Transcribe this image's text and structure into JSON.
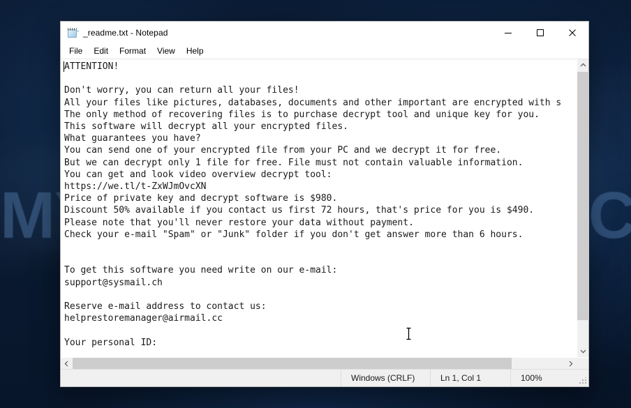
{
  "desktop": {
    "watermark_text": "MYANTISPYWARE.COM",
    "background_color": "#0a1b33",
    "watermark_color": "#78aae6"
  },
  "window": {
    "title": "_readme.txt - Notepad",
    "icon": "notepad-icon",
    "controls": {
      "minimize": "Minimize",
      "maximize": "Maximize",
      "close": "Close"
    }
  },
  "menubar": {
    "items": [
      {
        "label": "File"
      },
      {
        "label": "Edit"
      },
      {
        "label": "Format"
      },
      {
        "label": "View"
      },
      {
        "label": "Help"
      }
    ]
  },
  "editor": {
    "content": "ATTENTION!\n\nDon't worry, you can return all your files!\nAll your files like pictures, databases, documents and other important are encrypted with s\nThe only method of recovering files is to purchase decrypt tool and unique key for you.\nThis software will decrypt all your encrypted files.\nWhat guarantees you have?\nYou can send one of your encrypted file from your PC and we decrypt it for free.\nBut we can decrypt only 1 file for free. File must not contain valuable information.\nYou can get and look video overview decrypt tool:\nhttps://we.tl/t-ZxWJmOvcXN\nPrice of private key and decrypt software is $980.\nDiscount 50% available if you contact us first 72 hours, that's price for you is $490.\nPlease note that you'll never restore your data without payment.\nCheck your e-mail \"Spam\" or \"Junk\" folder if you don't get answer more than 6 hours.\n\n\nTo get this software you need write on our e-mail:\nsupport@sysmail.ch\n\nReserve e-mail address to contact us:\nhelprestoremanager@airmail.cc\n\nYour personal ID:",
    "lines": [
      "ATTENTION!",
      "",
      "Don't worry, you can return all your files!",
      "All your files like pictures, databases, documents and other important are encrypted with s",
      "The only method of recovering files is to purchase decrypt tool and unique key for you.",
      "This software will decrypt all your encrypted files.",
      "What guarantees you have?",
      "You can send one of your encrypted file from your PC and we decrypt it for free.",
      "But we can decrypt only 1 file for free. File must not contain valuable information.",
      "You can get and look video overview decrypt tool:",
      "https://we.tl/t-ZxWJmOvcXN",
      "Price of private key and decrypt software is $980.",
      "Discount 50% available if you contact us first 72 hours, that's price for you is $490.",
      "Please note that you'll never restore your data without payment.",
      "Check your e-mail \"Spam\" or \"Junk\" folder if you don't get answer more than 6 hours.",
      "",
      "",
      "To get this software you need write on our e-mail:",
      "support@sysmail.ch",
      "",
      "Reserve e-mail address to contact us:",
      "helprestoremanager@airmail.cc",
      "",
      "Your personal ID:"
    ],
    "ransom_details": {
      "video_url": "https://we.tl/t-ZxWJmOvcXN",
      "full_price": "$980",
      "discount_price": "$490",
      "discount_percent": "50%",
      "discount_window": "72 hours",
      "reply_window": "6 hours",
      "primary_email": "support@sysmail.ch",
      "reserve_email": "helprestoremanager@airmail.cc"
    }
  },
  "statusbar": {
    "eol": "Windows (CRLF)",
    "position": "Ln 1, Col 1",
    "zoom": "100%"
  }
}
